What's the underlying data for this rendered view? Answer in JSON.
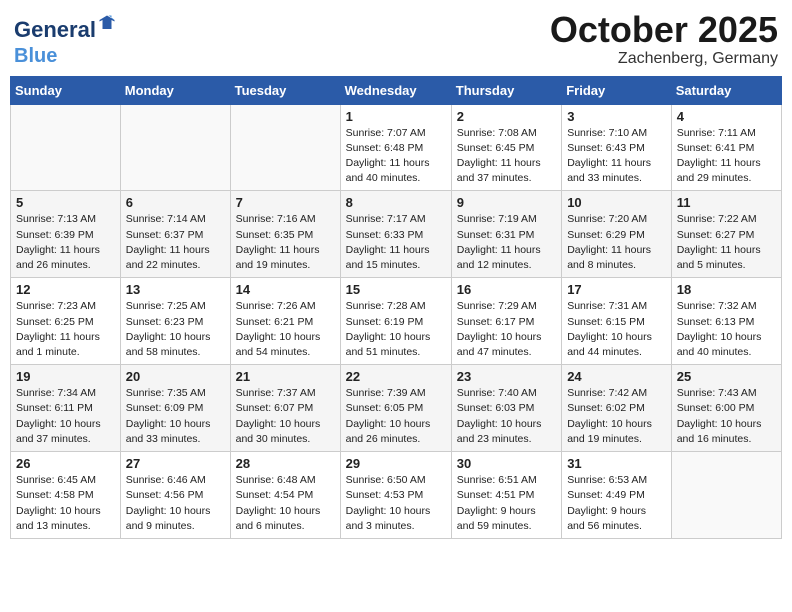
{
  "logo": {
    "line1": "General",
    "line2": "Blue"
  },
  "title": "October 2025",
  "location": "Zachenberg, Germany",
  "weekdays": [
    "Sunday",
    "Monday",
    "Tuesday",
    "Wednesday",
    "Thursday",
    "Friday",
    "Saturday"
  ],
  "weeks": [
    [
      {
        "day": "",
        "info": ""
      },
      {
        "day": "",
        "info": ""
      },
      {
        "day": "",
        "info": ""
      },
      {
        "day": "1",
        "info": "Sunrise: 7:07 AM\nSunset: 6:48 PM\nDaylight: 11 hours\nand 40 minutes."
      },
      {
        "day": "2",
        "info": "Sunrise: 7:08 AM\nSunset: 6:45 PM\nDaylight: 11 hours\nand 37 minutes."
      },
      {
        "day": "3",
        "info": "Sunrise: 7:10 AM\nSunset: 6:43 PM\nDaylight: 11 hours\nand 33 minutes."
      },
      {
        "day": "4",
        "info": "Sunrise: 7:11 AM\nSunset: 6:41 PM\nDaylight: 11 hours\nand 29 minutes."
      }
    ],
    [
      {
        "day": "5",
        "info": "Sunrise: 7:13 AM\nSunset: 6:39 PM\nDaylight: 11 hours\nand 26 minutes."
      },
      {
        "day": "6",
        "info": "Sunrise: 7:14 AM\nSunset: 6:37 PM\nDaylight: 11 hours\nand 22 minutes."
      },
      {
        "day": "7",
        "info": "Sunrise: 7:16 AM\nSunset: 6:35 PM\nDaylight: 11 hours\nand 19 minutes."
      },
      {
        "day": "8",
        "info": "Sunrise: 7:17 AM\nSunset: 6:33 PM\nDaylight: 11 hours\nand 15 minutes."
      },
      {
        "day": "9",
        "info": "Sunrise: 7:19 AM\nSunset: 6:31 PM\nDaylight: 11 hours\nand 12 minutes."
      },
      {
        "day": "10",
        "info": "Sunrise: 7:20 AM\nSunset: 6:29 PM\nDaylight: 11 hours\nand 8 minutes."
      },
      {
        "day": "11",
        "info": "Sunrise: 7:22 AM\nSunset: 6:27 PM\nDaylight: 11 hours\nand 5 minutes."
      }
    ],
    [
      {
        "day": "12",
        "info": "Sunrise: 7:23 AM\nSunset: 6:25 PM\nDaylight: 11 hours\nand 1 minute."
      },
      {
        "day": "13",
        "info": "Sunrise: 7:25 AM\nSunset: 6:23 PM\nDaylight: 10 hours\nand 58 minutes."
      },
      {
        "day": "14",
        "info": "Sunrise: 7:26 AM\nSunset: 6:21 PM\nDaylight: 10 hours\nand 54 minutes."
      },
      {
        "day": "15",
        "info": "Sunrise: 7:28 AM\nSunset: 6:19 PM\nDaylight: 10 hours\nand 51 minutes."
      },
      {
        "day": "16",
        "info": "Sunrise: 7:29 AM\nSunset: 6:17 PM\nDaylight: 10 hours\nand 47 minutes."
      },
      {
        "day": "17",
        "info": "Sunrise: 7:31 AM\nSunset: 6:15 PM\nDaylight: 10 hours\nand 44 minutes."
      },
      {
        "day": "18",
        "info": "Sunrise: 7:32 AM\nSunset: 6:13 PM\nDaylight: 10 hours\nand 40 minutes."
      }
    ],
    [
      {
        "day": "19",
        "info": "Sunrise: 7:34 AM\nSunset: 6:11 PM\nDaylight: 10 hours\nand 37 minutes."
      },
      {
        "day": "20",
        "info": "Sunrise: 7:35 AM\nSunset: 6:09 PM\nDaylight: 10 hours\nand 33 minutes."
      },
      {
        "day": "21",
        "info": "Sunrise: 7:37 AM\nSunset: 6:07 PM\nDaylight: 10 hours\nand 30 minutes."
      },
      {
        "day": "22",
        "info": "Sunrise: 7:39 AM\nSunset: 6:05 PM\nDaylight: 10 hours\nand 26 minutes."
      },
      {
        "day": "23",
        "info": "Sunrise: 7:40 AM\nSunset: 6:03 PM\nDaylight: 10 hours\nand 23 minutes."
      },
      {
        "day": "24",
        "info": "Sunrise: 7:42 AM\nSunset: 6:02 PM\nDaylight: 10 hours\nand 19 minutes."
      },
      {
        "day": "25",
        "info": "Sunrise: 7:43 AM\nSunset: 6:00 PM\nDaylight: 10 hours\nand 16 minutes."
      }
    ],
    [
      {
        "day": "26",
        "info": "Sunrise: 6:45 AM\nSunset: 4:58 PM\nDaylight: 10 hours\nand 13 minutes."
      },
      {
        "day": "27",
        "info": "Sunrise: 6:46 AM\nSunset: 4:56 PM\nDaylight: 10 hours\nand 9 minutes."
      },
      {
        "day": "28",
        "info": "Sunrise: 6:48 AM\nSunset: 4:54 PM\nDaylight: 10 hours\nand 6 minutes."
      },
      {
        "day": "29",
        "info": "Sunrise: 6:50 AM\nSunset: 4:53 PM\nDaylight: 10 hours\nand 3 minutes."
      },
      {
        "day": "30",
        "info": "Sunrise: 6:51 AM\nSunset: 4:51 PM\nDaylight: 9 hours\nand 59 minutes."
      },
      {
        "day": "31",
        "info": "Sunrise: 6:53 AM\nSunset: 4:49 PM\nDaylight: 9 hours\nand 56 minutes."
      },
      {
        "day": "",
        "info": ""
      }
    ]
  ]
}
